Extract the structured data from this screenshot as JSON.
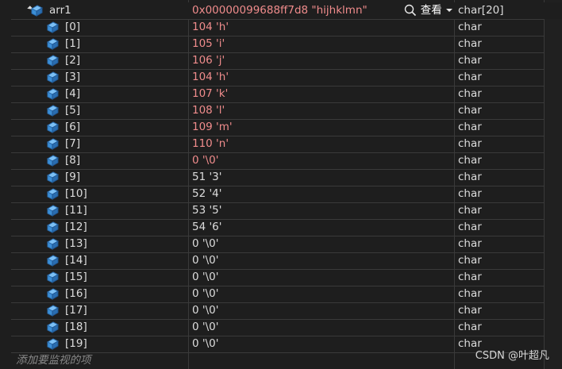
{
  "root": {
    "name": "arr1",
    "value": "0x00000099688ff7d8 \"hijhklmn\"",
    "type": "char[20]",
    "view_label": "查看"
  },
  "rows": [
    {
      "name": "[0]",
      "value": "104 'h'",
      "type": "char",
      "changed": true
    },
    {
      "name": "[1]",
      "value": "105 'i'",
      "type": "char",
      "changed": true
    },
    {
      "name": "[2]",
      "value": "106 'j'",
      "type": "char",
      "changed": true
    },
    {
      "name": "[3]",
      "value": "104 'h'",
      "type": "char",
      "changed": true
    },
    {
      "name": "[4]",
      "value": "107 'k'",
      "type": "char",
      "changed": true
    },
    {
      "name": "[5]",
      "value": "108 'l'",
      "type": "char",
      "changed": true
    },
    {
      "name": "[6]",
      "value": "109 'm'",
      "type": "char",
      "changed": true
    },
    {
      "name": "[7]",
      "value": "110 'n'",
      "type": "char",
      "changed": true
    },
    {
      "name": "[8]",
      "value": "0 '\\0'",
      "type": "char",
      "changed": true
    },
    {
      "name": "[9]",
      "value": "51 '3'",
      "type": "char",
      "changed": false
    },
    {
      "name": "[10]",
      "value": "52 '4'",
      "type": "char",
      "changed": false
    },
    {
      "name": "[11]",
      "value": "53 '5'",
      "type": "char",
      "changed": false
    },
    {
      "name": "[12]",
      "value": "54 '6'",
      "type": "char",
      "changed": false
    },
    {
      "name": "[13]",
      "value": "0 '\\0'",
      "type": "char",
      "changed": false
    },
    {
      "name": "[14]",
      "value": "0 '\\0'",
      "type": "char",
      "changed": false
    },
    {
      "name": "[15]",
      "value": "0 '\\0'",
      "type": "char",
      "changed": false
    },
    {
      "name": "[16]",
      "value": "0 '\\0'",
      "type": "char",
      "changed": false
    },
    {
      "name": "[17]",
      "value": "0 '\\0'",
      "type": "char",
      "changed": false
    },
    {
      "name": "[18]",
      "value": "0 '\\0'",
      "type": "char",
      "changed": false
    },
    {
      "name": "[19]",
      "value": "0 '\\0'",
      "type": "char",
      "changed": false
    }
  ],
  "add_watch_placeholder": "添加要监视的项",
  "watermark": "CSDN @叶超凡",
  "colors": {
    "changed_value": "#f08c8c",
    "icon_blue": "#3c8fd6"
  }
}
